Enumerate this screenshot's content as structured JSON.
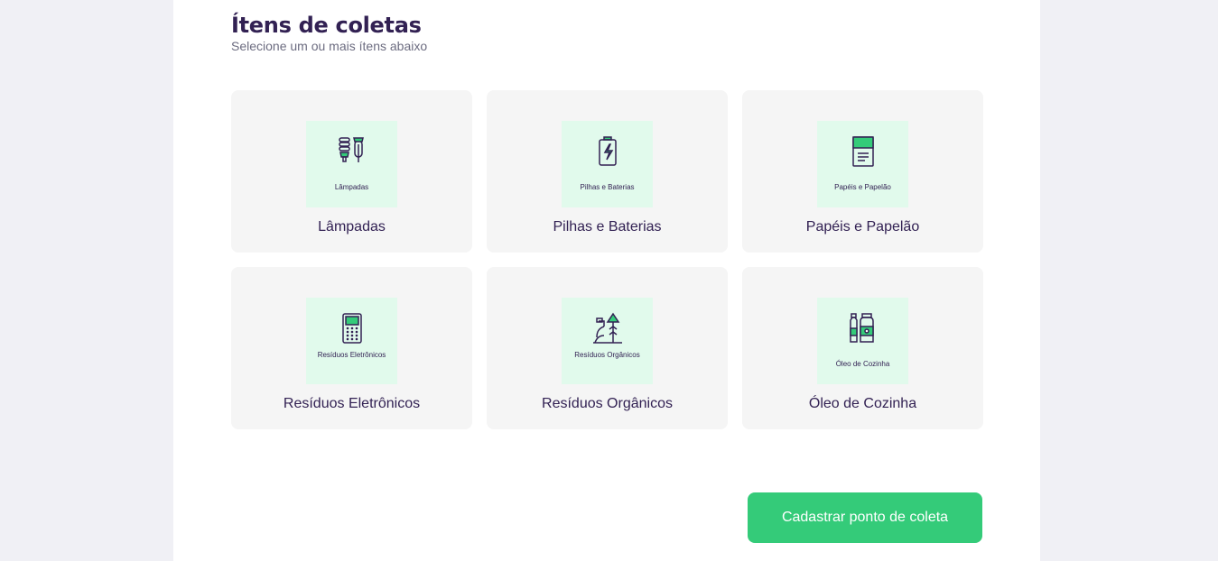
{
  "section": {
    "title": "Ítens de coletas",
    "subtitle": "Selecione um ou mais ítens abaixo"
  },
  "items": [
    {
      "label": "Lâmpadas",
      "thumb_text": "Lâmpadas",
      "icon": "lamp-icon"
    },
    {
      "label": "Pilhas e Baterias",
      "thumb_text": "Pilhas e Baterias",
      "icon": "battery-icon"
    },
    {
      "label": "Papéis e Papelão",
      "thumb_text": "Papéis e Papelão",
      "icon": "paper-icon"
    },
    {
      "label": "Resíduos Eletrônicos",
      "thumb_text": "Resíduos Eletrônicos",
      "icon": "electronics-icon"
    },
    {
      "label": "Resíduos Orgânicos",
      "thumb_text": "Resíduos Orgânicos",
      "icon": "organic-icon"
    },
    {
      "label": "Óleo de Cozinha",
      "thumb_text": "Óleo de Cozinha",
      "icon": "oil-icon"
    }
  ],
  "submit_label": "Cadastrar ponto de coleta",
  "colors": {
    "primary": "#34CB79",
    "title": "#322153",
    "text": "#6C6C80",
    "card_bg": "#F5F5F5",
    "thumb_bg": "#E1FAEC",
    "page_bg": "#F0F0F5"
  }
}
